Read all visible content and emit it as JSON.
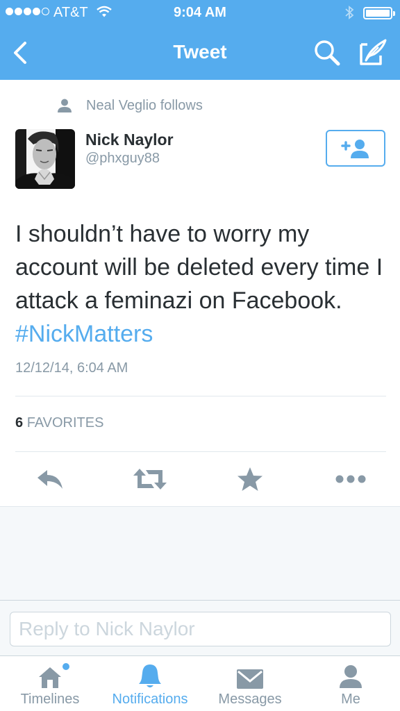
{
  "status_bar": {
    "carrier": "AT&T",
    "time": "9:04 AM",
    "signal_bars": 4,
    "signal_max": 5,
    "battery_level": 1.0
  },
  "nav": {
    "title": "Tweet",
    "icons": [
      "back-chevron-icon",
      "search-icon",
      "compose-icon"
    ]
  },
  "social_context": {
    "text": "Neal Veglio follows",
    "icon": "person-icon"
  },
  "author": {
    "name": "Nick Naylor",
    "handle": "@phxguy88",
    "follow_icon": "follow-add-person-icon"
  },
  "tweet": {
    "text": "I shouldn’t have to worry my account will be deleted every time I attack a feminazi on Facebook.",
    "hashtag": "#NickMatters",
    "timestamp": "12/12/14, 6:04 AM"
  },
  "stats": {
    "favorites_count": "6",
    "favorites_label": "FAVORITES"
  },
  "actions": [
    "reply-icon",
    "retweet-icon",
    "favorite-star-icon",
    "more-dots-icon"
  ],
  "reply": {
    "placeholder": "Reply to Nick Naylor",
    "value": ""
  },
  "tabs": [
    {
      "label": "Timelines",
      "icon": "home-icon",
      "active": false,
      "has_badge": true
    },
    {
      "label": "Notifications",
      "icon": "bell-icon",
      "active": true,
      "has_badge": false
    },
    {
      "label": "Messages",
      "icon": "envelope-icon",
      "active": false,
      "has_badge": false
    },
    {
      "label": "Me",
      "icon": "person-icon",
      "active": false,
      "has_badge": false
    }
  ],
  "colors": {
    "brand": "#55acee",
    "text": "#292f33",
    "muted": "#8899a6",
    "icon_gray": "#8899a6",
    "divider": "#e1e8ed",
    "background_gray": "#f5f8fa"
  }
}
